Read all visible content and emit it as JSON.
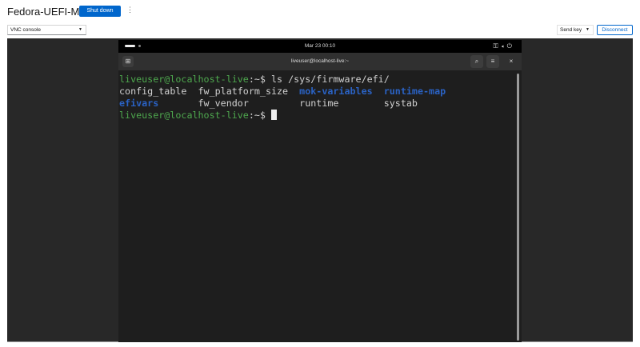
{
  "header": {
    "title": "Fedora-UEFI-MTE",
    "shutdown_label": "Shut down",
    "kebab": "⋮"
  },
  "toolbar": {
    "console_select": "VNC console",
    "send_key": "Send key",
    "disconnect": "Disconnect"
  },
  "guest": {
    "clock": "Mar 23  00:10",
    "terminal_title": "liveuser@localhost-live:~",
    "lines": {
      "prompt1": "liveuser@localhost-live",
      "cmd1": ":~$ ls /sys/firmware/efi/",
      "r1a": "config_table  fw_platform_size  ",
      "r1b": "mok-variables",
      "r1c": "  ",
      "r1d": "runtime-map",
      "r2a": "efivars",
      "r2b": "       fw_vendor         runtime        systab",
      "prompt2": "liveuser@localhost-live",
      "cmd2": ":~$ "
    }
  }
}
